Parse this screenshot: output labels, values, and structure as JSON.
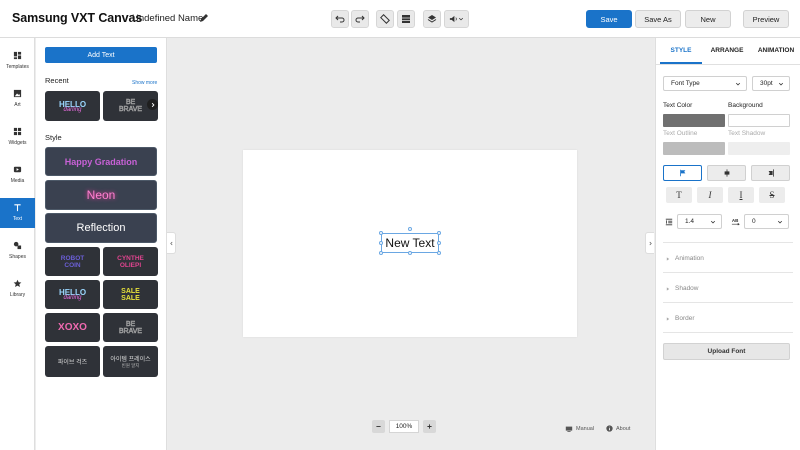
{
  "header": {
    "app_title": "Samsung VXT Canvas",
    "doc_name": "Undefined Name",
    "buttons": {
      "save": "Save",
      "save_as": "Save As",
      "new": "New",
      "preview": "Preview"
    },
    "tools": [
      "undo-icon",
      "redo-icon",
      "ruler-icon",
      "grid-icon",
      "layers-icon",
      "volume-icon"
    ]
  },
  "nav": {
    "items": [
      {
        "label": "Templates",
        "icon": "templates-icon"
      },
      {
        "label": "Art",
        "icon": "art-icon"
      },
      {
        "label": "Widgets",
        "icon": "widgets-icon"
      },
      {
        "label": "Media",
        "icon": "media-icon"
      },
      {
        "label": "Text",
        "icon": "text-icon"
      },
      {
        "label": "Shapes",
        "icon": "shapes-icon"
      },
      {
        "label": "Library",
        "icon": "library-icon"
      }
    ],
    "active": "Text"
  },
  "text_panel": {
    "add_text": "Add Text",
    "recent_label": "Recent",
    "show_more": "Show more",
    "style_label": "Style",
    "recent": [
      {
        "line1": "HELLO",
        "line2": "darling"
      },
      {
        "line1": "BE",
        "line2": "BRAVE"
      }
    ],
    "styles_wide": [
      "Happy Gradation",
      "Neon",
      "Reflection"
    ],
    "styles_grid": [
      {
        "line1": "ROBOT",
        "line2": "COIN"
      },
      {
        "line1": "CYNTHE",
        "line2": "OLIEPI"
      },
      {
        "line1": "HELLO",
        "line2": "darling"
      },
      {
        "line1": "SALE",
        "line2": "SALE"
      },
      {
        "line1": "XOXO",
        "line2": ""
      },
      {
        "line1": "BE",
        "line2": "BRAVE"
      },
      {
        "line1": "파이브 걱즈",
        "line2": ""
      },
      {
        "line1": "아이템 프레이스",
        "line2": "빈원 알지"
      }
    ]
  },
  "canvas": {
    "text": "New Text",
    "zoom": "100%",
    "manual": "Manual",
    "about": "About"
  },
  "right_panel": {
    "tabs": [
      "STYLE",
      "ARRANGE",
      "ANIMATION"
    ],
    "font_type": "Font Type",
    "font_size": "30pt",
    "text_color_label": "Text Color",
    "background_label": "Background",
    "text_outline_label": "Text Outline",
    "text_shadow_label": "Text Shadow",
    "text_color": "#707070",
    "line_height": "1.4",
    "letter_spacing": "0",
    "style_buttons": [
      "T",
      "I",
      "I",
      "S"
    ],
    "accordions": [
      "Animation",
      "Shadow",
      "Border"
    ],
    "upload_font": "Upload Font"
  }
}
